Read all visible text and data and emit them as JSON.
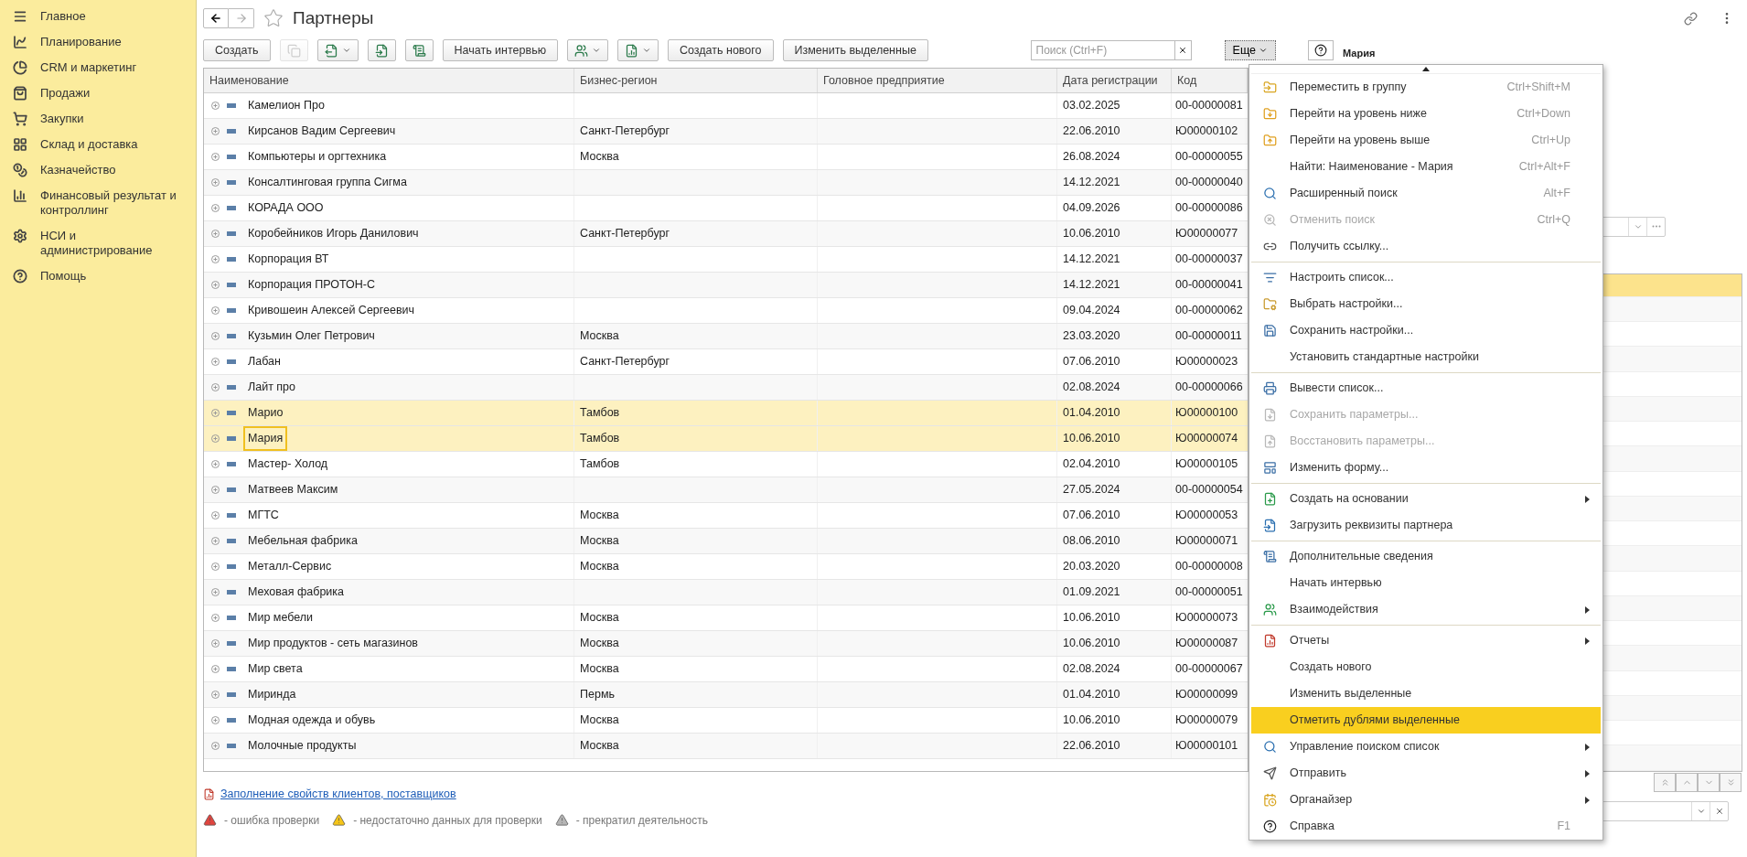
{
  "sidebar": {
    "items": [
      {
        "label": "Главное"
      },
      {
        "label": "Планирование"
      },
      {
        "label": "CRM и маркетинг"
      },
      {
        "label": "Продажи"
      },
      {
        "label": "Закупки"
      },
      {
        "label": "Склад и доставка"
      },
      {
        "label": "Казначейство"
      },
      {
        "label": "Финансовый результат и контроллинг"
      },
      {
        "label": "НСИ и администрирование"
      },
      {
        "label": "Помощь"
      }
    ]
  },
  "header": {
    "title": "Партнеры"
  },
  "toolbar": [
    {
      "kind": "text",
      "label": "Создать",
      "disabled": false
    },
    {
      "kind": "icon",
      "disabled": true
    },
    {
      "kind": "icon_menu",
      "disabled": false
    },
    {
      "kind": "icon",
      "disabled": false
    },
    {
      "kind": "icon",
      "disabled": false
    },
    {
      "kind": "text",
      "label": "Начать интервью",
      "disabled": false
    },
    {
      "kind": "icon_menu",
      "disabled": false
    },
    {
      "kind": "icon_menu",
      "disabled": false
    },
    {
      "kind": "text",
      "label": "Создать нового",
      "disabled": false
    },
    {
      "kind": "text",
      "label": "Изменить выделенные",
      "disabled": false
    }
  ],
  "search": {
    "placeholder": "Поиск (Ctrl+F)"
  },
  "more_button": {
    "label": "Еще",
    "pressed": true
  },
  "table": {
    "columns": [
      "Наименование",
      "Бизнес-регион",
      "Головное предприятие",
      "Дата регистрации",
      "Код"
    ],
    "rows": [
      {
        "name": "Камелион Про",
        "region": "",
        "date": "03.02.2025",
        "code": "00-00000081",
        "selected": false,
        "focused": false
      },
      {
        "name": "Кирсанов Вадим Сергеевич",
        "region": "Санкт-Петербург",
        "date": "22.06.2010",
        "code": "Ю00000102",
        "selected": false,
        "focused": false
      },
      {
        "name": "Компьютеры и оргтехника",
        "region": "Москва",
        "date": "26.08.2024",
        "code": "00-00000055",
        "selected": false,
        "focused": false
      },
      {
        "name": "Консалтинговая группа Сигма",
        "region": "",
        "date": "14.12.2021",
        "code": "00-00000040",
        "selected": false,
        "focused": false
      },
      {
        "name": "КОРАДА ООО",
        "region": "",
        "date": "04.09.2026",
        "code": "00-00000086",
        "selected": false,
        "focused": false
      },
      {
        "name": "Коробейников Игорь Данилович",
        "region": "Санкт-Петербург",
        "date": "10.06.2010",
        "code": "Ю00000077",
        "selected": false,
        "focused": false
      },
      {
        "name": "Корпорация ВТ",
        "region": "",
        "date": "14.12.2021",
        "code": "00-00000037",
        "selected": false,
        "focused": false
      },
      {
        "name": "Корпорация ПРОТОН-С",
        "region": "",
        "date": "14.12.2021",
        "code": "00-00000041",
        "selected": false,
        "focused": false
      },
      {
        "name": "Кривошеин Алексей Сергеевич",
        "region": "",
        "date": "09.04.2024",
        "code": "00-00000062",
        "selected": false,
        "focused": false
      },
      {
        "name": "Кузьмин Олег Петрович",
        "region": "Москва",
        "date": "23.03.2020",
        "code": "00-00000011",
        "selected": false,
        "focused": false
      },
      {
        "name": "Лабан",
        "region": "Санкт-Петербург",
        "date": "07.06.2010",
        "code": "Ю00000023",
        "selected": false,
        "focused": false
      },
      {
        "name": "Лайт про",
        "region": "",
        "date": "02.08.2024",
        "code": "00-00000066",
        "selected": false,
        "focused": false
      },
      {
        "name": "Марио",
        "region": "Тамбов",
        "date": "01.04.2010",
        "code": "Ю00000100",
        "selected": true,
        "focused": false
      },
      {
        "name": "Мария",
        "region": "Тамбов",
        "date": "10.06.2010",
        "code": "Ю00000074",
        "selected": true,
        "focused": true
      },
      {
        "name": "Мастер- Холод",
        "region": "Тамбов",
        "date": "02.04.2010",
        "code": "Ю00000105",
        "selected": false,
        "focused": false
      },
      {
        "name": "Матвеев Максим",
        "region": "",
        "date": "27.05.2024",
        "code": "00-00000054",
        "selected": false,
        "focused": false
      },
      {
        "name": "МГТС",
        "region": "Москва",
        "date": "07.06.2010",
        "code": "Ю00000053",
        "selected": false,
        "focused": false
      },
      {
        "name": "Мебельная фабрика",
        "region": "Москва",
        "date": "08.06.2010",
        "code": "Ю00000071",
        "selected": false,
        "focused": false
      },
      {
        "name": "Металл-Сервис",
        "region": "Москва",
        "date": "20.03.2020",
        "code": "00-00000008",
        "selected": false,
        "focused": false
      },
      {
        "name": "Меховая фабрика",
        "region": "",
        "date": "01.09.2021",
        "code": "00-00000051",
        "selected": false,
        "focused": false
      },
      {
        "name": "Мир мебели",
        "region": "Москва",
        "date": "10.06.2010",
        "code": "Ю00000073",
        "selected": false,
        "focused": false
      },
      {
        "name": "Мир продуктов - сеть магазинов",
        "region": "Москва",
        "date": "10.06.2010",
        "code": "Ю00000087",
        "selected": false,
        "focused": false
      },
      {
        "name": "Мир света",
        "region": "Москва",
        "date": "02.08.2024",
        "code": "00-00000067",
        "selected": false,
        "focused": false
      },
      {
        "name": "Миринда",
        "region": "Пермь",
        "date": "01.04.2010",
        "code": "Ю00000099",
        "selected": false,
        "focused": false
      },
      {
        "name": "Модная одежда и обувь",
        "region": "Москва",
        "date": "10.06.2010",
        "code": "Ю00000079",
        "selected": false,
        "focused": false
      },
      {
        "name": "Молочные продукты",
        "region": "Москва",
        "date": "22.06.2010",
        "code": "Ю00000101",
        "selected": false,
        "focused": false
      }
    ]
  },
  "footer": {
    "link": "Заполнение свойств клиентов, поставщиков",
    "legend": [
      {
        "label": "- ошибка проверки",
        "color": "#e0443e"
      },
      {
        "label": "- недостаточно данных для проверки",
        "color": "#f5c518"
      },
      {
        "label": "- прекратил деятельность",
        "color": "#b5b5b5"
      }
    ]
  },
  "side_panel": {
    "title": "Мария"
  },
  "menu": {
    "groups": [
      {
        "items": [
          {
            "label": "Переместить в группу",
            "shortcut": "Ctrl+Shift+M",
            "disabled": false,
            "submenu": false,
            "selected": false
          },
          {
            "label": "Перейти на уровень ниже",
            "shortcut": "Ctrl+Down",
            "disabled": false,
            "submenu": false,
            "selected": false
          },
          {
            "label": "Перейти на уровень выше",
            "shortcut": "Ctrl+Up",
            "disabled": false,
            "submenu": false,
            "selected": false
          },
          {
            "label": "Найти: Наименование - Мария",
            "shortcut": "Ctrl+Alt+F",
            "disabled": false,
            "submenu": false,
            "selected": false
          },
          {
            "label": "Расширенный поиск",
            "shortcut": "Alt+F",
            "disabled": false,
            "submenu": false,
            "selected": false
          },
          {
            "label": "Отменить поиск",
            "shortcut": "Ctrl+Q",
            "disabled": true,
            "submenu": false,
            "selected": false
          },
          {
            "label": "Получить ссылку...",
            "disabled": false,
            "submenu": false,
            "selected": false
          }
        ]
      },
      {
        "items": [
          {
            "label": "Настроить список...",
            "disabled": false,
            "submenu": false,
            "selected": false
          },
          {
            "label": "Выбрать настройки...",
            "disabled": false,
            "submenu": false,
            "selected": false
          },
          {
            "label": "Сохранить настройки...",
            "disabled": false,
            "submenu": false,
            "selected": false
          },
          {
            "label": "Установить стандартные настройки",
            "disabled": false,
            "submenu": false,
            "selected": false
          }
        ]
      },
      {
        "items": [
          {
            "label": "Вывести список...",
            "disabled": false,
            "submenu": false,
            "selected": false
          },
          {
            "label": "Сохранить параметры...",
            "disabled": true,
            "submenu": false,
            "selected": false
          },
          {
            "label": "Восстановить параметры...",
            "disabled": true,
            "submenu": false,
            "selected": false
          },
          {
            "label": "Изменить форму...",
            "disabled": false,
            "submenu": false,
            "selected": false
          }
        ]
      },
      {
        "items": [
          {
            "label": "Создать на основании",
            "disabled": false,
            "submenu": true,
            "selected": false
          },
          {
            "label": "Загрузить реквизиты партнера",
            "disabled": false,
            "submenu": false,
            "selected": false
          }
        ]
      },
      {
        "items": [
          {
            "label": "Дополнительные сведения",
            "disabled": false,
            "submenu": false,
            "selected": false
          },
          {
            "label": "Начать интервью",
            "disabled": false,
            "submenu": false,
            "selected": false
          },
          {
            "label": "Взаимодействия",
            "disabled": false,
            "submenu": true,
            "selected": false
          }
        ]
      },
      {
        "items": [
          {
            "label": "Отчеты",
            "disabled": false,
            "submenu": true,
            "selected": false
          },
          {
            "label": "Создать нового",
            "disabled": false,
            "submenu": false,
            "selected": false
          },
          {
            "label": "Изменить выделенные",
            "disabled": false,
            "submenu": false,
            "selected": false
          },
          {
            "label": "Отметить дублями выделенные",
            "disabled": false,
            "submenu": false,
            "selected": true
          },
          {
            "label": "Управление поиском список",
            "disabled": false,
            "submenu": true,
            "selected": false
          },
          {
            "label": "Отправить",
            "disabled": false,
            "submenu": true,
            "selected": false
          },
          {
            "label": "Органайзер",
            "disabled": false,
            "submenu": true,
            "selected": false
          },
          {
            "label": "Справка",
            "shortcut": "F1",
            "disabled": false,
            "submenu": false,
            "selected": false
          }
        ]
      }
    ]
  }
}
